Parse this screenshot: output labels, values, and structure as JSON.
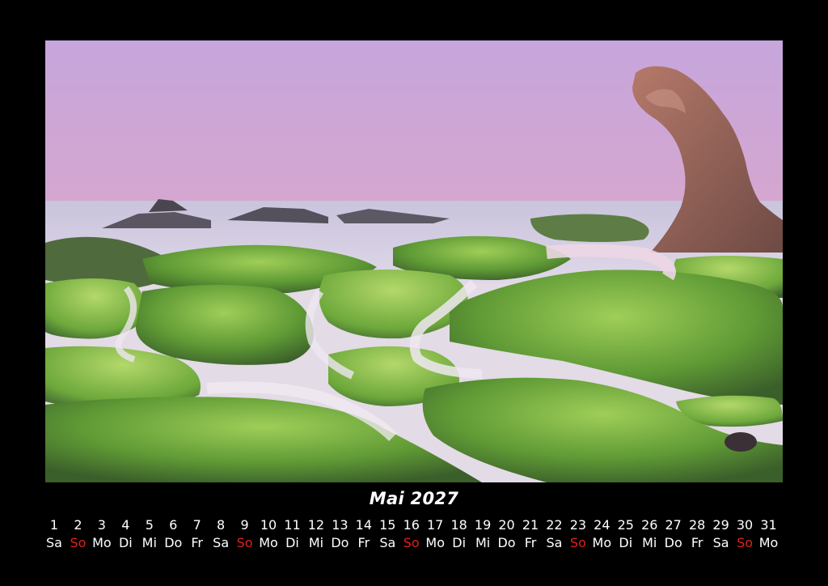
{
  "calendar": {
    "month_title": "Mai 2027",
    "sunday_color": "#e0201b",
    "days": [
      {
        "num": "1",
        "wd": "Sa"
      },
      {
        "num": "2",
        "wd": "So"
      },
      {
        "num": "3",
        "wd": "Mo"
      },
      {
        "num": "4",
        "wd": "Di"
      },
      {
        "num": "5",
        "wd": "Mi"
      },
      {
        "num": "6",
        "wd": "Do"
      },
      {
        "num": "7",
        "wd": "Fr"
      },
      {
        "num": "8",
        "wd": "Sa"
      },
      {
        "num": "9",
        "wd": "So"
      },
      {
        "num": "10",
        "wd": "Mo"
      },
      {
        "num": "11",
        "wd": "Di"
      },
      {
        "num": "12",
        "wd": "Mi"
      },
      {
        "num": "13",
        "wd": "Do"
      },
      {
        "num": "14",
        "wd": "Fr"
      },
      {
        "num": "15",
        "wd": "Sa"
      },
      {
        "num": "16",
        "wd": "So"
      },
      {
        "num": "17",
        "wd": "Mo"
      },
      {
        "num": "18",
        "wd": "Di"
      },
      {
        "num": "19",
        "wd": "Mi"
      },
      {
        "num": "20",
        "wd": "Do"
      },
      {
        "num": "21",
        "wd": "Fr"
      },
      {
        "num": "22",
        "wd": "Sa"
      },
      {
        "num": "23",
        "wd": "So"
      },
      {
        "num": "24",
        "wd": "Mo"
      },
      {
        "num": "25",
        "wd": "Di"
      },
      {
        "num": "26",
        "wd": "Mi"
      },
      {
        "num": "27",
        "wd": "Do"
      },
      {
        "num": "28",
        "wd": "Fr"
      },
      {
        "num": "29",
        "wd": "Sa"
      },
      {
        "num": "30",
        "wd": "So"
      },
      {
        "num": "31",
        "wd": "Mo"
      }
    ]
  }
}
